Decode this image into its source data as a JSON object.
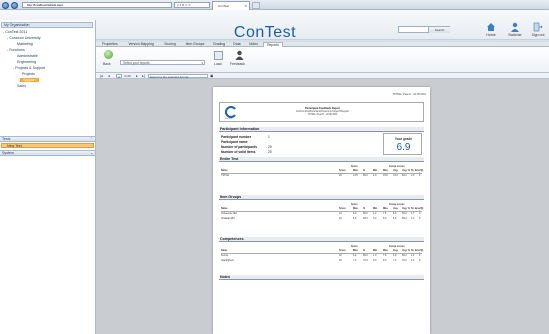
{
  "browser": {
    "address": "http://localhost/default.aspx",
    "search_hint": "ρ ▾ ⊗ C ✕",
    "tab_title": "ConTest"
  },
  "header": {
    "organization": "My Organisation",
    "app_title": "ConTest",
    "search_button": "Search",
    "actions": [
      "Home",
      "Switcher",
      "Sign out"
    ]
  },
  "sidebar": {
    "tree": [
      {
        "label": "- ConTest 2011",
        "level": 0
      },
      {
        "label": "- Constron University",
        "level": 1
      },
      {
        "label": "Marketing",
        "level": 2
      },
      {
        "label": "- Functions",
        "level": 1
      },
      {
        "label": "Administratie",
        "level": 2
      },
      {
        "label": "Engineering",
        "level": 2
      },
      {
        "label": "- Projects & Support",
        "level": 2
      },
      {
        "label": "Projects",
        "level": 3
      },
      {
        "label": "Support",
        "level": 3,
        "selected": true
      },
      {
        "label": "Sales",
        "level": 2
      }
    ],
    "tests_header": "Tests",
    "new_test": "New Test",
    "system_header": "System"
  },
  "ribbon": {
    "tabs": [
      "Properties",
      "Version Mapping",
      "Scoring",
      "Item Groups",
      "Grading",
      "Data",
      "Notes",
      "Reports"
    ],
    "active_tab": "Reports"
  },
  "toolbar": {
    "back": "Back",
    "report_placeholder": "Select your reports",
    "load": "Load",
    "feedback": "Feedback",
    "page_current": "1",
    "page_of": "of 20",
    "export_label": "Export to the selected format"
  },
  "report": {
    "header_date": "TSTMA / Peal H - 22.08.2011",
    "title": "Participant Feedback Report",
    "subtitle1": "ConTest 2011/Functions/Projects & Support/Support",
    "subtitle2": "TSTMA / Peal H - 22.08.2011",
    "logo_text": "ConTest",
    "participant_section": "Participant information",
    "info": [
      {
        "label": "Participant number",
        "value": "1"
      },
      {
        "label": "Participant name",
        "value": ""
      },
      {
        "label": "Number of participants",
        "value": "20"
      },
      {
        "label": "Number of valid items",
        "value": "20"
      }
    ],
    "grade_label": "Your grade",
    "grade_value": "6.9",
    "entire_test_section": "Entire Test",
    "item_groups_section": "Item Groups",
    "competences_section": "Competences",
    "notes_section": "Notes",
    "score_group": "Score",
    "group_scores": "Group scores",
    "columns": [
      "Name",
      "Score",
      "Max.",
      "%",
      "Min.",
      "Max.",
      "Avg.",
      "Avg. %",
      "St. dev.",
      "z/(t) >"
    ],
    "entire_rows": [
      [
        "TSTMA",
        "20",
        "13.8",
        "69.0",
        "4.0",
        "15.8",
        "13.8",
        "69.0",
        "2.3",
        "0"
      ]
    ],
    "group_rows": [
      [
        "Verkeerde 1&2",
        "10",
        "6.9",
        "69.0",
        "1.0",
        "7.6",
        "6.9",
        "69.2",
        "1.7",
        "0"
      ],
      [
        "Vraaktal 3&4",
        "10",
        "6.9",
        "69.0",
        "3.0",
        "9.0",
        "6.9",
        "69.2",
        "1.2",
        "0"
      ]
    ],
    "comp_rows": [
      [
        "Kennis",
        "10",
        "6.9",
        "69.0",
        "1.0",
        "7.6",
        "6.9",
        "69.2",
        "1.2",
        "0"
      ],
      [
        "Vaardigheid",
        "10",
        "7.0",
        "70.0",
        "3.0",
        "9.0",
        "7.0",
        "70.0",
        "1.4",
        "0"
      ]
    ]
  }
}
